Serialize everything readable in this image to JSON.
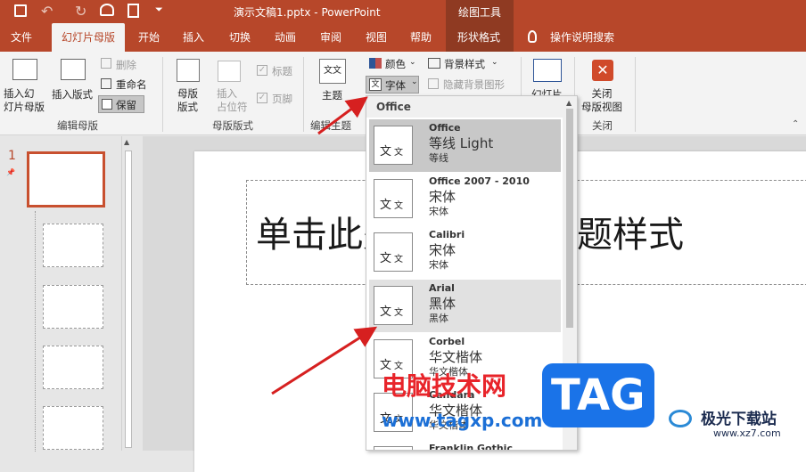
{
  "titlebar": {
    "title": "演示文稿1.pptx - PowerPoint",
    "context_group": "绘图工具"
  },
  "tabs": [
    "文件",
    "幻灯片母版",
    "开始",
    "插入",
    "切换",
    "动画",
    "审阅",
    "视图",
    "帮助",
    "形状格式",
    "操作说明搜索"
  ],
  "ribbon": {
    "insert_master": "插入幻\n灯片母版",
    "insert_layout": "插入版式",
    "delete": "删除",
    "rename": "重命名",
    "preserve": "保留",
    "group_edit_master": "编辑母版",
    "master_layout": "母版\n版式",
    "insert_placeholder": "插入\n占位符",
    "title_chk": "标题",
    "footer_chk": "页脚",
    "group_master_layout": "母版版式",
    "themes": "主题",
    "group_edit_theme": "编辑主题",
    "colors": "颜色",
    "fonts": "字体",
    "bg_styles": "背景样式",
    "hide_bg": "隐藏背景图形",
    "slide_size": "幻灯片",
    "close_master": "关闭\n母版视图",
    "group_close": "关闭"
  },
  "slide": {
    "number": "1",
    "title_placeholder": "单击此处编辑母版标题样式"
  },
  "fonts_dropdown": {
    "header": "Office",
    "items": [
      {
        "name": "Office",
        "heading": "等线 Light",
        "body": "等线",
        "state": "selected"
      },
      {
        "name": "Office 2007 - 2010",
        "heading": "宋体",
        "body": "宋体",
        "state": "normal"
      },
      {
        "name": "Calibri",
        "heading": "宋体",
        "body": "宋体",
        "state": "normal"
      },
      {
        "name": "Arial",
        "heading": "黑体",
        "body": "黑体",
        "state": "hover"
      },
      {
        "name": "Corbel",
        "heading": "华文楷体",
        "body": "华文楷体",
        "state": "normal"
      },
      {
        "name": "Candara",
        "heading": "华文楷体",
        "body": "华文楷体",
        "state": "normal"
      },
      {
        "name": "Franklin Gothic",
        "heading": "",
        "body": "",
        "state": "normal"
      }
    ]
  },
  "watermarks": {
    "site_cn": "电脑技术网",
    "site_url": "www.tagxp.com",
    "tag_logo": "TAG",
    "jg_name": "极光下载站",
    "jg_url": "www.xz7.com"
  },
  "colors": {
    "accent": "#b7472a",
    "arrow": "#d62020",
    "tag_blue": "#1a73e8"
  }
}
